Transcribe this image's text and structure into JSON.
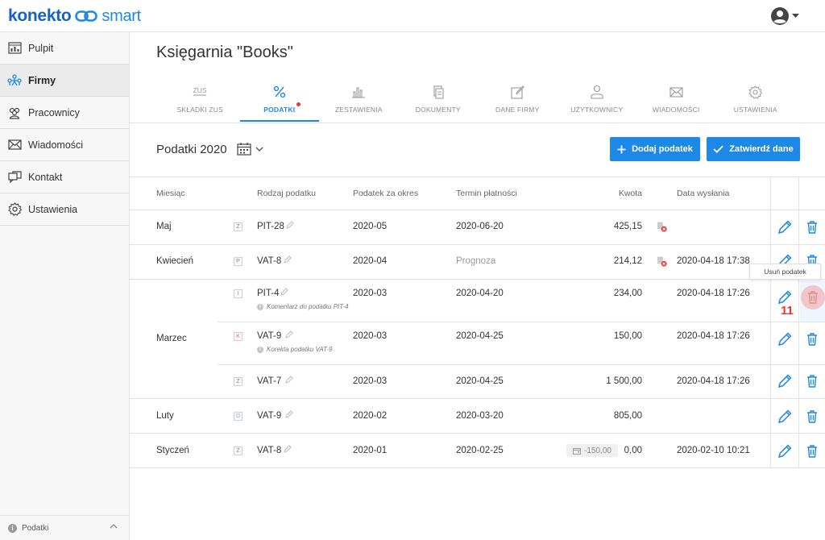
{
  "app": {
    "logo_left": "konekto",
    "logo_right": "smart"
  },
  "colors": {
    "accent": "#1e88e5",
    "logo": "#1662c4",
    "danger": "#e53935"
  },
  "sidebar": {
    "items": [
      {
        "label": "Pulpit",
        "icon": "dashboard-icon"
      },
      {
        "label": "Firmy",
        "icon": "companies-icon",
        "active": true
      },
      {
        "label": "Pracownicy",
        "icon": "employees-icon"
      },
      {
        "label": "Wiadomości",
        "icon": "envelope-icon"
      },
      {
        "label": "Kontakt",
        "icon": "chat-icon"
      },
      {
        "label": "Ustawienia",
        "icon": "gear-icon"
      }
    ],
    "footer_label": "Podatki"
  },
  "page": {
    "company_title": "Księgarnia \"Books\""
  },
  "tabs": [
    {
      "label": "SKŁADKI ZUS",
      "icon": "zus-icon"
    },
    {
      "label": "PODATKI",
      "icon": "percent-icon",
      "active": true,
      "has_dot": true
    },
    {
      "label": "ZESTAWIENIA",
      "icon": "bar-chart-icon"
    },
    {
      "label": "DOKUMENTY",
      "icon": "documents-icon"
    },
    {
      "label": "DANE FIRMY",
      "icon": "edit-icon"
    },
    {
      "label": "UŻYTKOWNICY",
      "icon": "user-icon"
    },
    {
      "label": "WIADOMOŚCI",
      "icon": "envelope-icon"
    },
    {
      "label": "USTAWIENIA",
      "icon": "gear-icon"
    }
  ],
  "toolbar": {
    "section_title": "Podatki 2020",
    "add_label": "Dodaj podatek",
    "confirm_label": "Zatwierdź dane"
  },
  "table": {
    "headers": {
      "month": "Miesiąc",
      "type": "Rodzaj podatku",
      "period": "Podatek za okres",
      "due": "Termin płatności",
      "amount": "Kwota",
      "sent": "Data wysłania"
    },
    "rows": [
      {
        "month": "Maj",
        "badge": "Z",
        "type": "PIT-28",
        "period": "2020-05",
        "due": "2020-06-20",
        "amount": "425,15",
        "sent": ""
      },
      {
        "month": "Kwiecień",
        "badge": "P",
        "type": "VAT-8",
        "period": "2020-04",
        "due": "Prognoza",
        "amount": "214,12",
        "sent": "2020-04-18 17:38"
      },
      {
        "month": "Marzec",
        "badge": "I",
        "type": "PIT-4",
        "note": "Komentarz do podatku PIT-4",
        "period": "2020-03",
        "due": "2020-04-20",
        "amount": "234,00",
        "sent": "2020-04-18 17:26"
      },
      {
        "month": "",
        "badge": "K",
        "type": "VAT-9",
        "note": "Korekta podatku VAT-9",
        "period": "2020-03",
        "due": "2020-04-25",
        "amount": "150,00",
        "sent": "2020-04-18 17:26"
      },
      {
        "month": "",
        "badge": "Z",
        "type": "VAT-7",
        "period": "2020-03",
        "due": "2020-04-25",
        "amount": "1 500,00",
        "sent": "2020-04-18 17:26"
      },
      {
        "month": "Luty",
        "badge": "D",
        "type": "VAT-9",
        "period": "2020-02",
        "due": "2020-03-20",
        "amount": "805,00",
        "sent": ""
      },
      {
        "month": "Styczeń",
        "badge": "Z",
        "type": "VAT-8",
        "period": "2020-01",
        "due": "2020-02-25",
        "credit": "-150,00",
        "amount": "0,00",
        "sent": "2020-02-10 10:21"
      }
    ]
  },
  "tooltip": "Usuń podatek",
  "step_number": "11"
}
